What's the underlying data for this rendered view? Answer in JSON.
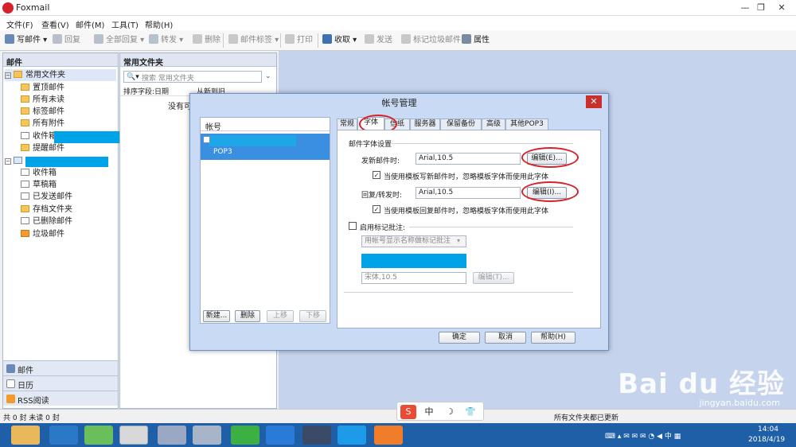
{
  "app": {
    "title": "Foxmail",
    "window_buttons": [
      "—",
      "❐",
      "✕"
    ]
  },
  "menu": [
    "文件(F)",
    "查看(V)",
    "邮件(M)",
    "工具(T)",
    "帮助(H)"
  ],
  "toolbar": {
    "write": "写邮件",
    "reply": "回复",
    "reply_all": "全部回复",
    "forward": "转发",
    "delete": "删除",
    "tag": "邮件标签",
    "print": "打印",
    "receive": "收取",
    "send": "发送",
    "mark_junk": "标记垃圾邮件",
    "properties": "属性"
  },
  "left_pane": {
    "header": "邮件",
    "common_folder": "常用文件夹",
    "common_items": [
      "置顶邮件",
      "所有未读",
      "标签邮件",
      "所有附件",
      "收件箱",
      "提醒邮件"
    ],
    "account_items": [
      "收件箱",
      "草稿箱",
      "已发送邮件",
      "存档文件夹",
      "已删除邮件",
      "垃圾邮件"
    ],
    "nav": [
      "邮件",
      "日历",
      "RSS阅读"
    ]
  },
  "mid_pane": {
    "header": "常用文件夹",
    "search_placeholder": "搜索 常用文件夹",
    "sort_label": "排序字段:日期",
    "sort_order": "从新到旧",
    "empty": "没有可"
  },
  "dialog": {
    "title": "帐号管理",
    "list_header": "帐号",
    "account_type": "POP3",
    "buttons": {
      "new": "新建...",
      "delete": "删除",
      "up": "上移",
      "down": "下移",
      "ok": "确定",
      "cancel": "取消",
      "help": "帮助(H)"
    },
    "tabs": [
      "常规",
      "字体",
      "信纸",
      "服务器",
      "保留备份",
      "高级",
      "其他POP3"
    ],
    "active_tab": "字体",
    "section": "邮件字体设置",
    "send_label": "发新邮件时:",
    "send_font": "Arial,10.5",
    "send_edit": "编辑(E)...",
    "send_check": "当使用模板写新邮件时，忽略模板字体而使用此字体",
    "reply_label": "回复/转发时:",
    "reply_font": "Arial,10.5",
    "reply_edit": "编辑(I)...",
    "reply_check": "当使用模板回复邮件时，忽略模板字体而使用此字体",
    "annot_label": "启用标记批注:",
    "annot_select": "用帐号显示名称做标记批注",
    "annot_font": "宋体,10.5",
    "annot_edit": "编辑(T)..."
  },
  "status": {
    "left": "共 0 封  未读 0 封",
    "right": "所有文件夹都已更新"
  },
  "ime": [
    "S",
    "中",
    "☽",
    "👕"
  ],
  "taskbar": {
    "time": "14:04",
    "date": "2018/4/19"
  },
  "watermark": {
    "brand": "Bai du 经验",
    "url": "jingyan.baidu.com"
  },
  "colors": {
    "accent": "#00a2e8",
    "highlight": "#d8222a"
  }
}
